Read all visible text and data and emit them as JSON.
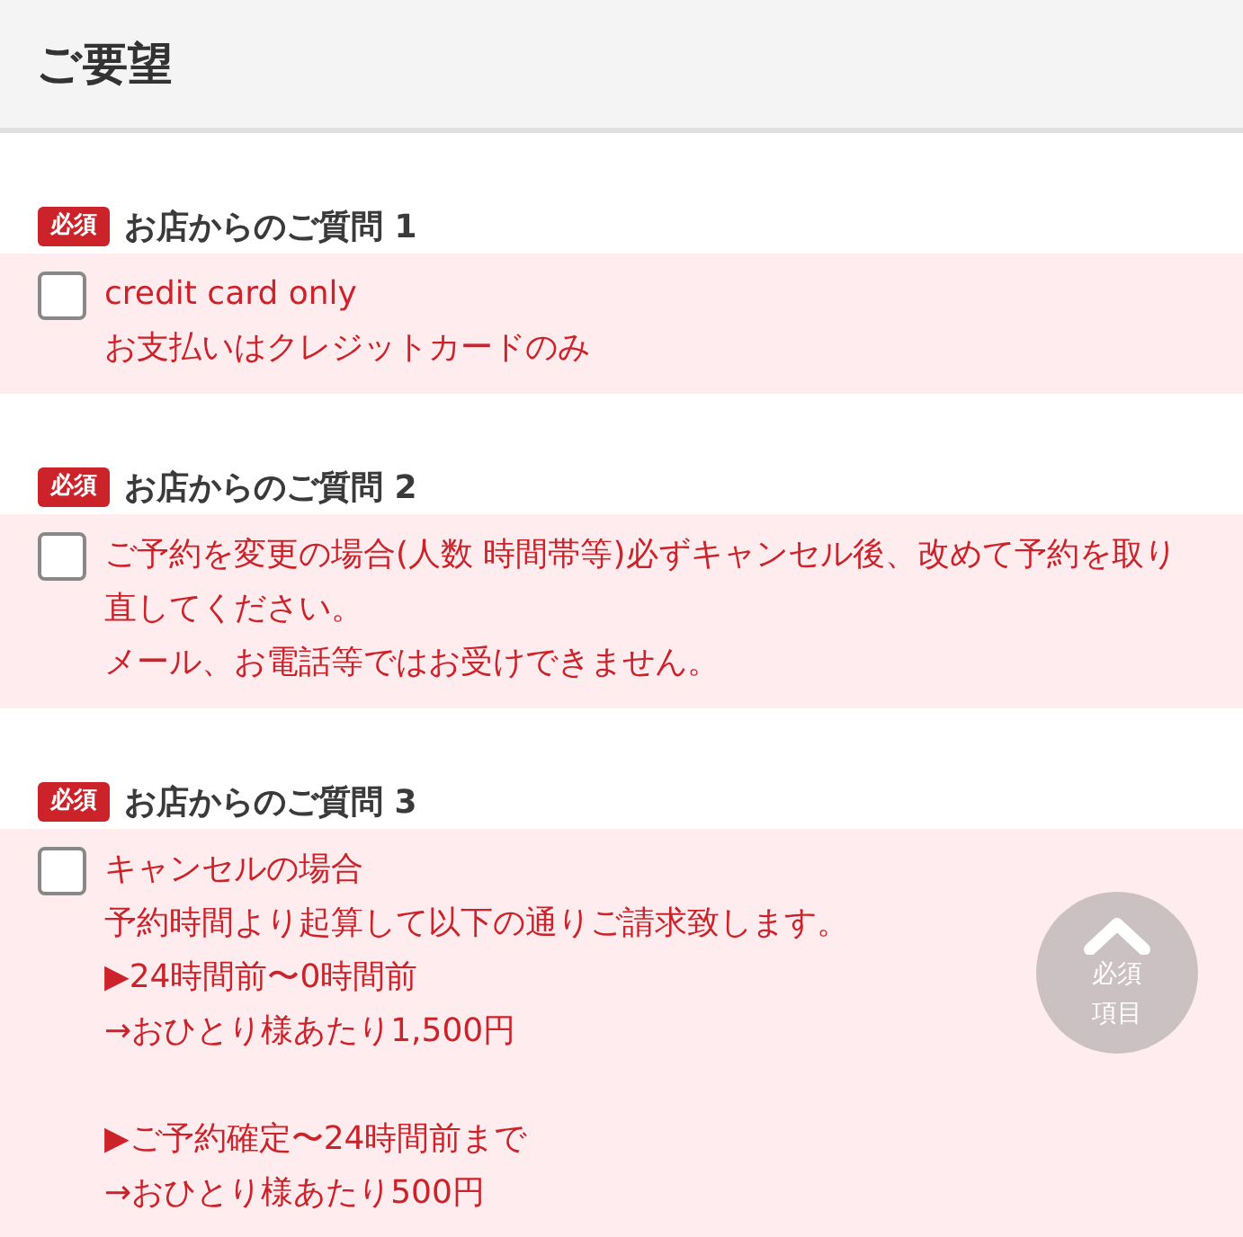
{
  "header": {
    "title": "ご要望"
  },
  "questions": [
    {
      "badge": "必須",
      "title": "お店からのご質問 1",
      "checked": false,
      "paragraphs": [
        [
          "credit card only",
          "お支払いはクレジットカードのみ"
        ]
      ]
    },
    {
      "badge": "必須",
      "title": "お店からのご質問 2",
      "checked": false,
      "paragraphs": [
        [
          "ご予約を変更の場合(人数 時間帯等)必ずキャンセル後、改めて予約を取り直してください。",
          "メール、お電話等ではお受けできません。"
        ]
      ]
    },
    {
      "badge": "必須",
      "title": "お店からのご質問 3",
      "checked": false,
      "paragraphs": [
        [
          "キャンセルの場合",
          "予約時間より起算して以下の通りご請求致します。",
          "▶24時間前〜0時間前",
          "→おひとり様あたり1,500円"
        ],
        [
          "▶ご予約確定〜24時間前まで",
          "→おひとり様あたり500円"
        ]
      ]
    }
  ],
  "scroll_button": {
    "lines": [
      "必須",
      "項目"
    ]
  }
}
